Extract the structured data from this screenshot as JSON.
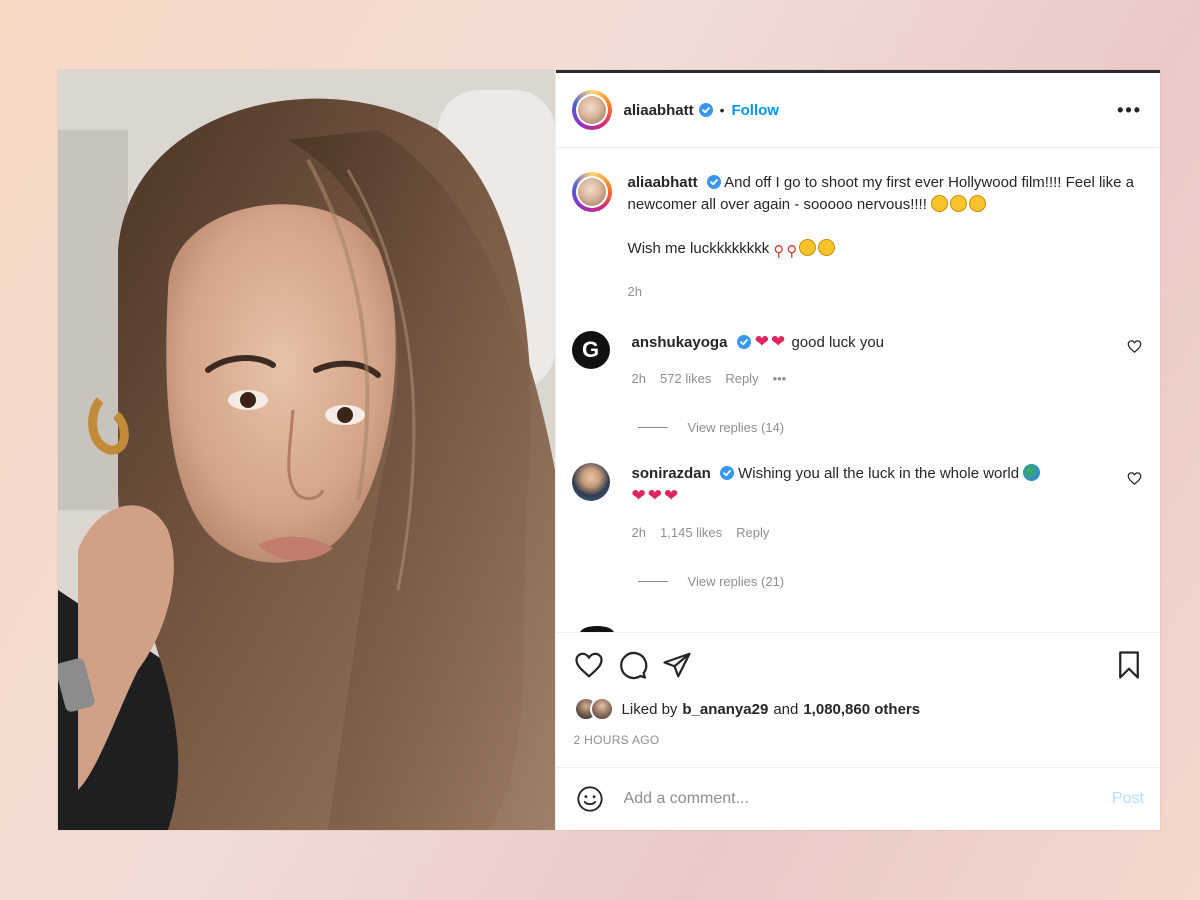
{
  "header": {
    "username": "aliaabhatt",
    "separator": "•",
    "follow_label": "Follow",
    "more_label": "•••",
    "verified_icon": "verified-badge-icon"
  },
  "caption": {
    "username": "aliaabhatt",
    "line1": "And off I go to shoot my first ever Hollywood film!!!! Feel like a newcomer all over again - sooooo nervous!!!!",
    "line1_emojis": [
      "grimace",
      "grimace",
      "grimace"
    ],
    "line2": "Wish me luckkkkkkkk",
    "line2_emojis": [
      "pin",
      "pin",
      "nerd",
      "nerd"
    ],
    "time": "2h"
  },
  "comments": [
    {
      "username": "anshukayoga",
      "avatar_text": "G",
      "text": "good luck you",
      "prefix_emojis": [
        "heart",
        "heart"
      ],
      "time": "2h",
      "likes": "572 likes",
      "reply_label": "Reply",
      "options_label": "•••",
      "view_replies": "View replies (14)"
    },
    {
      "username": "sonirazdan",
      "text": "Wishing you all the luck in the whole world",
      "suffix_emojis": [
        "globe",
        "heart",
        "heart",
        "heart"
      ],
      "time": "2h",
      "likes": "1,145 likes",
      "reply_label": "Reply",
      "view_replies": "View replies (21)"
    }
  ],
  "actions": {
    "icons": [
      "heart-icon",
      "comment-icon",
      "share-icon",
      "bookmark-icon"
    ],
    "liked_by_prefix": "Liked by",
    "liked_by_user": "b_ananya29",
    "liked_by_conj": "and",
    "liked_by_others": "1,080,860 others",
    "posted_ago": "2 HOURS AGO"
  },
  "composer": {
    "placeholder": "Add a comment...",
    "post_label": "Post"
  },
  "colors": {
    "accent": "#0095f6",
    "post_disabled": "#b2dffc",
    "heart": "#e0245e",
    "verified": "#3897f0"
  }
}
